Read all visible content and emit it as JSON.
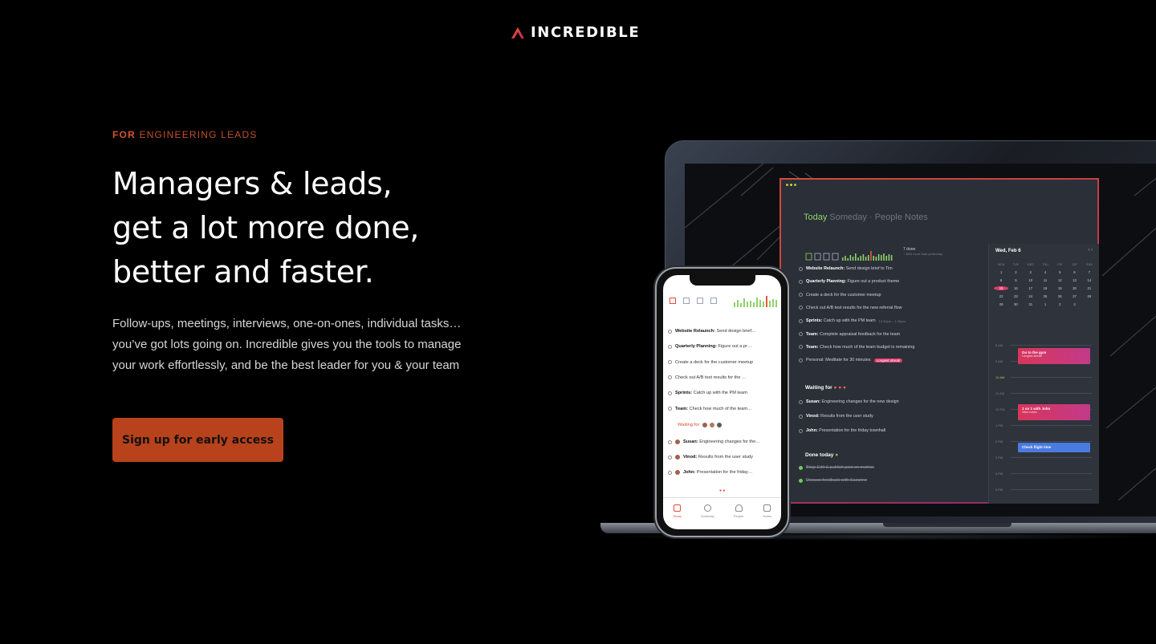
{
  "brand": {
    "name": "INCREDIBLE",
    "logo_icon": "a-chevron-logo",
    "accent": "#d8452f"
  },
  "hero": {
    "eyebrow_strong": "FOR",
    "eyebrow_rest": "ENGINEERING LEADS",
    "headline": [
      "Managers & leads,",
      "get a lot more done,",
      "better and faster."
    ],
    "description": "Follow-ups, meetings, interviews, one-on-ones, individual tasks… you’ve got lots going on. Incredible gives you the tools to manage your work effortlessly, and be the best leader for you & your team",
    "cta_label": "Sign up for early access",
    "cta_color": "#b8421b"
  },
  "desktop_app": {
    "tabs": {
      "today": "Today",
      "someday": "Someday",
      "sep": "·",
      "people": "People",
      "notes": "Notes"
    },
    "stat": {
      "done": "7 done",
      "sub": "↑ 38% more than yesterday"
    },
    "tasks": [
      {
        "bold": "Website Relaunch:",
        "text": " Send design brief to Tim"
      },
      {
        "bold": "Quarterly Planning:",
        "text": " Figure out a product theme"
      },
      {
        "bold": "",
        "text": "Create a deck for the customer meetup"
      },
      {
        "bold": "",
        "text": "Check out A/B test results for the new referral flow"
      },
      {
        "bold": "Sprints:",
        "text": " Catch up with the PM team"
      },
      {
        "bold": "Team:",
        "text": " Complete appraisal feedback for the team"
      },
      {
        "bold": "Team:",
        "text": " Check how much of the team budget is remaining"
      },
      {
        "bold": "",
        "text": "Personal: Meditate for 30 minutes"
      }
    ],
    "meeting_time": "12:30pm – 1:30pm",
    "streak": "Longest streak",
    "waiting_title": "Waiting for",
    "waiting": [
      {
        "bold": "Susan:",
        "text": " Engineering changes for the new design"
      },
      {
        "bold": "Vinod:",
        "text": " Results from the user study"
      },
      {
        "bold": "John:",
        "text": " Presentation for the friday townhall"
      }
    ],
    "done_title": "Done today",
    "done": [
      "Blog: Edit & publish post on metrics",
      "Discuss feedback with Suzanne"
    ],
    "calendar": {
      "title": "Wed, Feb 6",
      "nav": "‹  ›",
      "weekdays": [
        "MON",
        "TUE",
        "WED",
        "THU",
        "FRI",
        "SAT",
        "SUN"
      ],
      "days": [
        "1",
        "2",
        "3",
        "4",
        "5",
        "6",
        "7",
        "8",
        "9",
        "10",
        "11",
        "12",
        "13",
        "14",
        "15",
        "16",
        "17",
        "18",
        "19",
        "20",
        "21",
        "22",
        "23",
        "24",
        "25",
        "26",
        "27",
        "28",
        "29",
        "30",
        "31",
        "1",
        "2",
        "3"
      ],
      "selected": "15",
      "hours": [
        "8 AM",
        "9 AM",
        "10 AM",
        "11 AM",
        "12 PM",
        "1 PM",
        "2 PM",
        "3 PM",
        "4 PM",
        "5 PM"
      ],
      "events": [
        {
          "title": "Go to the gym",
          "sub": "Longest streak"
        },
        {
          "title": "1 on 1 with John",
          "sub": "View notes"
        },
        {
          "title": "Check flight time",
          "sub": ""
        }
      ]
    }
  },
  "phone_app": {
    "tasks": [
      {
        "bold": "Website Relaunch:",
        "text": " Send design brief…"
      },
      {
        "bold": "Quarterly Planning:",
        "text": " Figure out a pr…"
      },
      {
        "bold": "",
        "text": "Create a deck for the customer meetup"
      },
      {
        "bold": "",
        "text": "Check out A/B test results for the …"
      },
      {
        "bold": "Sprints:",
        "text": " Catch up with the PM team"
      },
      {
        "bold": "Team:",
        "text": " Check how much of the team…"
      }
    ],
    "waiting_title": "Waiting for",
    "waiting": [
      {
        "bold": "Susan:",
        "text": " Engineering changes for the…"
      },
      {
        "bold": "Vinod:",
        "text": " Results from the user study"
      },
      {
        "bold": "John:",
        "text": " Presentation for the friday…"
      }
    ],
    "tabbar": [
      "Today",
      "Someday",
      "People",
      "Notes"
    ]
  }
}
